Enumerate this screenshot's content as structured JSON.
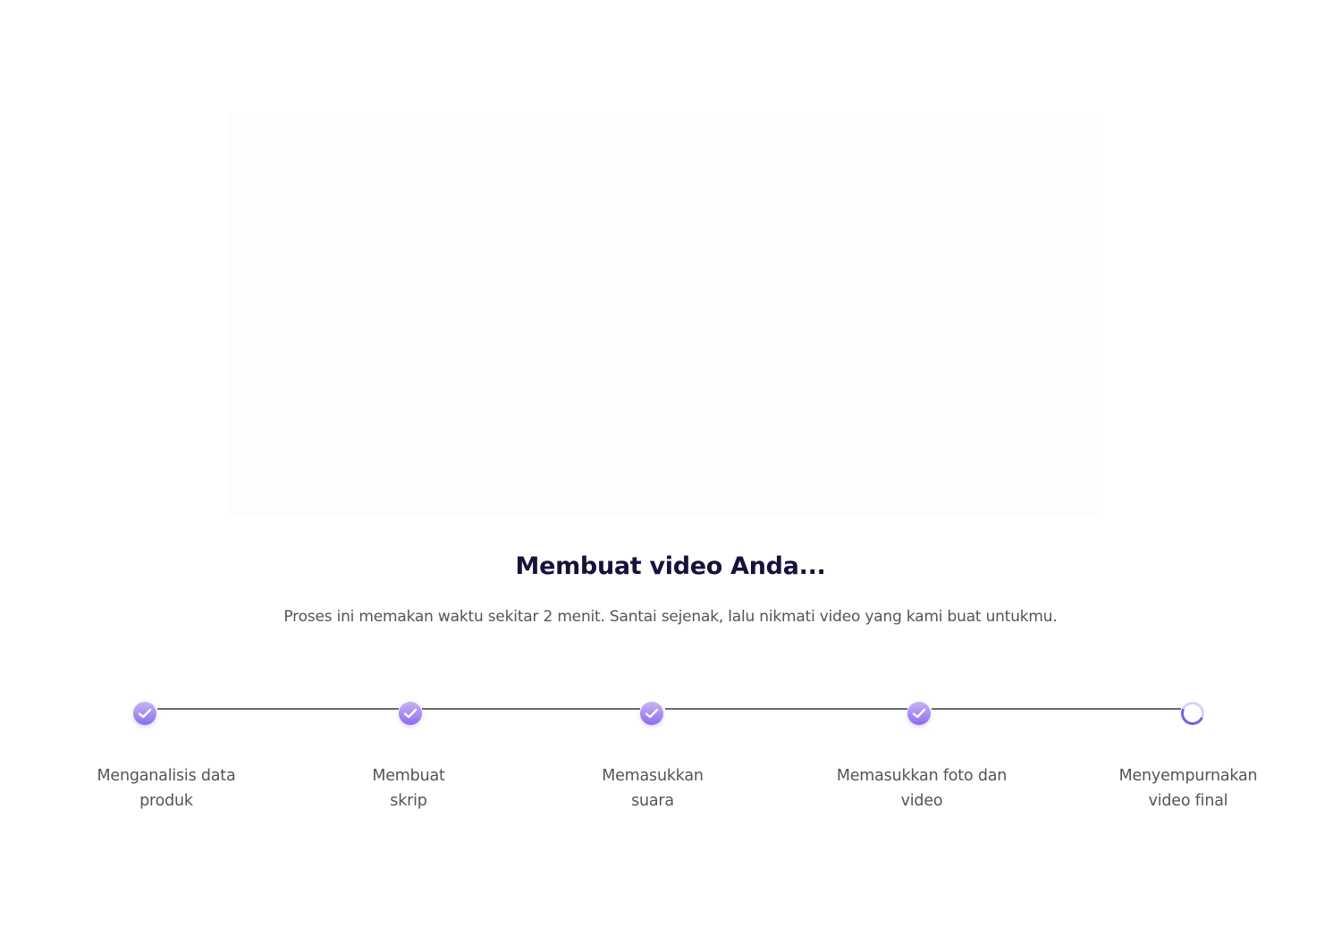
{
  "header": {
    "title": "Membuat video Anda...",
    "subtitle": "Proses ini memakan waktu sekitar 2 menit. Santai sejenak, lalu nikmati video yang kami buat untukmu."
  },
  "steps": [
    {
      "line1": "Menganalisis data",
      "line2": "produk",
      "status": "done",
      "icon": "check-circle-icon"
    },
    {
      "line1": "Membuat",
      "line2": "skrip",
      "status": "done",
      "icon": "check-circle-icon"
    },
    {
      "line1": "Memasukkan",
      "line2": "suara",
      "status": "done",
      "icon": "check-circle-icon"
    },
    {
      "line1": "Memasukkan foto dan",
      "line2": "video",
      "status": "done",
      "icon": "check-circle-icon"
    },
    {
      "line1": "Menyempurnakan",
      "line2": "video final",
      "status": "in-progress",
      "icon": "loading-spinner-icon"
    }
  ],
  "colors": {
    "accent": "#8d6cf0",
    "title": "#16123a",
    "text": "#555555"
  }
}
